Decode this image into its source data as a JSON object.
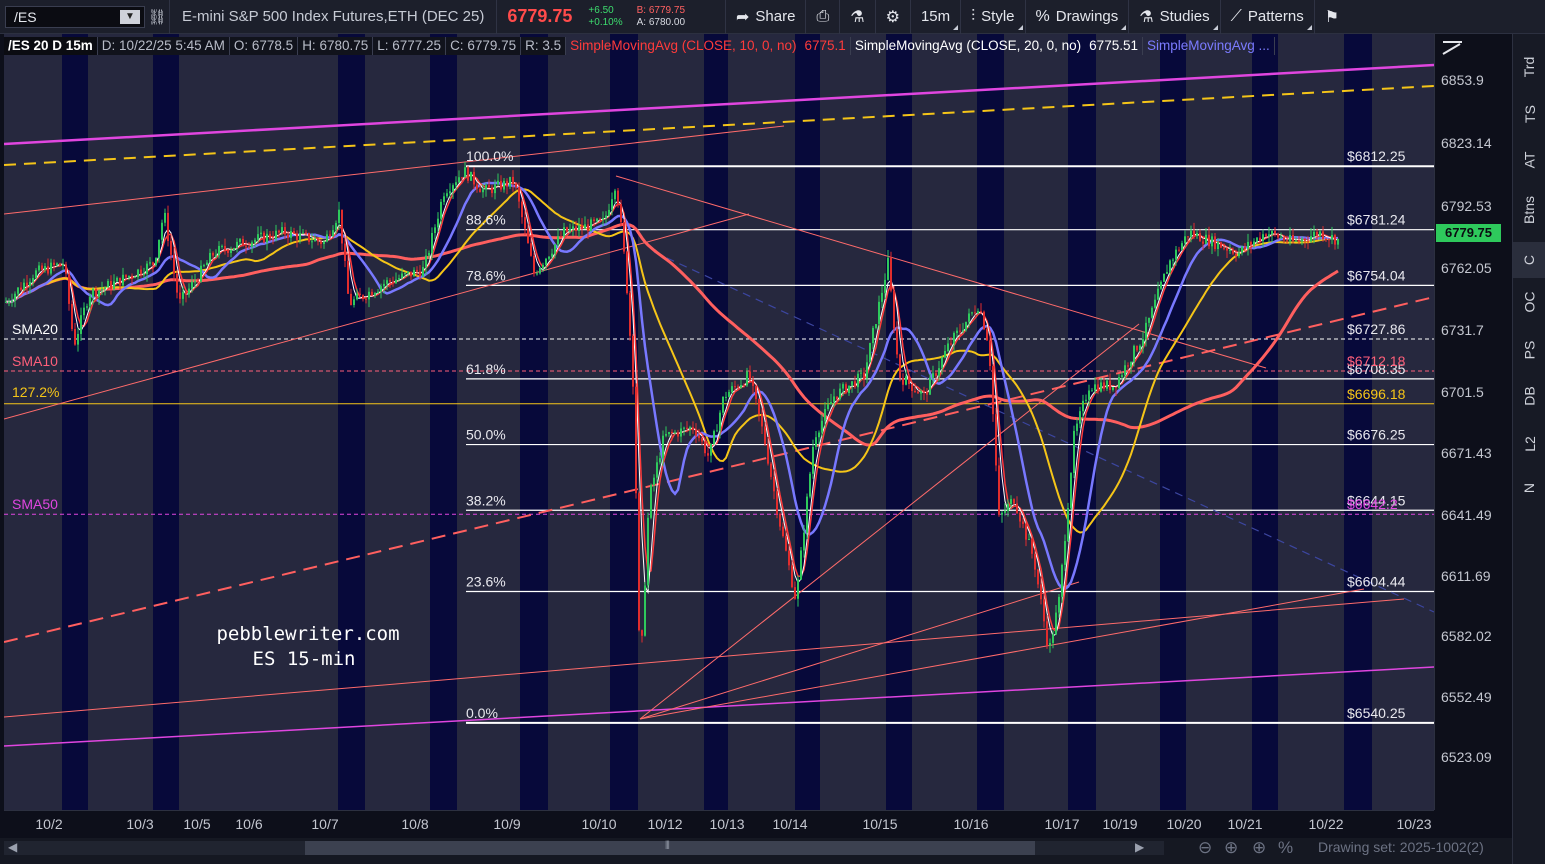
{
  "toolbar": {
    "symbol": "/ES",
    "instrument": "E-mini S&P 500 Index Futures,ETH (DEC 25)",
    "last": "6779.75",
    "change": "+6.50",
    "change_pct": "+0.10%",
    "bid": "B: 6779.75",
    "ask": "A: 6780.00",
    "share": "Share",
    "timeframe": "15m",
    "style": "Style",
    "drawings": "Drawings",
    "studies": "Studies",
    "patterns": "Patterns"
  },
  "header": {
    "symbol": "/ES 20 D 15m",
    "date": "D: 10/22/25 5:45 AM",
    "open": "O: 6778.5",
    "high": "H: 6780.75",
    "low": "L: 6777.25",
    "close": "C: 6779.75",
    "range": "R: 3.5",
    "sma10": "SimpleMovingAvg (CLOSE, 10, 0, no)",
    "sma10_val": "6775.1",
    "sma20": "SimpleMovingAvg (CLOSE, 20, 0, no)",
    "sma20_val": "6775.51",
    "sma50": "SimpleMovingAvg ..."
  },
  "price_axis": {
    "ticks": [
      "6853.9",
      "6823.14",
      "6792.53",
      "6762.05",
      "6731.7",
      "6701.5",
      "6671.43",
      "6641.49",
      "6611.69",
      "6582.02",
      "6552.49",
      "6523.09"
    ],
    "current": "6779.75"
  },
  "date_axis": {
    "ticks": [
      "10/2",
      "10/3",
      "10/5",
      "10/6",
      "10/7",
      "10/8",
      "10/9",
      "10/10",
      "10/12",
      "10/13",
      "10/14",
      "10/15",
      "10/16",
      "10/17",
      "10/19",
      "10/20",
      "10/21",
      "10/22",
      "10/23"
    ]
  },
  "fib": {
    "levels": [
      {
        "pct": "100.0%",
        "price": "$6812.25"
      },
      {
        "pct": "88.6%",
        "price": "$6781.24"
      },
      {
        "pct": "78.6%",
        "price": "$6754.04"
      },
      {
        "pct": "61.8%",
        "price": "$6708.35"
      },
      {
        "pct": "50.0%",
        "price": "$6676.25"
      },
      {
        "pct": "38.2%",
        "price": "$6644.15"
      },
      {
        "pct": "23.6%",
        "price": "$6604.44"
      },
      {
        "pct": "0.0%",
        "price": "$6540.25"
      }
    ],
    "sma20_price": "$6727.86",
    "sma10_price": "$6712.18",
    "ext_price": "$6696.18",
    "sma50_price": "$6642.2"
  },
  "annotations": {
    "sma20": "SMA20",
    "sma10": "SMA10",
    "ext": "127.2%",
    "sma50": "SMA50",
    "watermark1": "pebblewriter.com",
    "watermark2": "ES 15-min"
  },
  "right_tabs": [
    "Trd",
    "TS",
    "AT",
    "Btns",
    "C",
    "OC",
    "PS",
    "DB",
    "L2",
    "N"
  ],
  "footer": {
    "drawing_set": "Drawing set: 2025-1002(2)"
  },
  "colors": {
    "up": "#2ec95c",
    "down": "#e02d2d",
    "sma10": "#ff3b3b",
    "sma20": "#ffffff",
    "sma50": "#7878ff",
    "sma_yellow": "#f5c518",
    "sma_red_long": "#ff5f5f",
    "magenta": "#e046e0",
    "band_dark": "#07093a",
    "band_light": "#26283e"
  }
}
